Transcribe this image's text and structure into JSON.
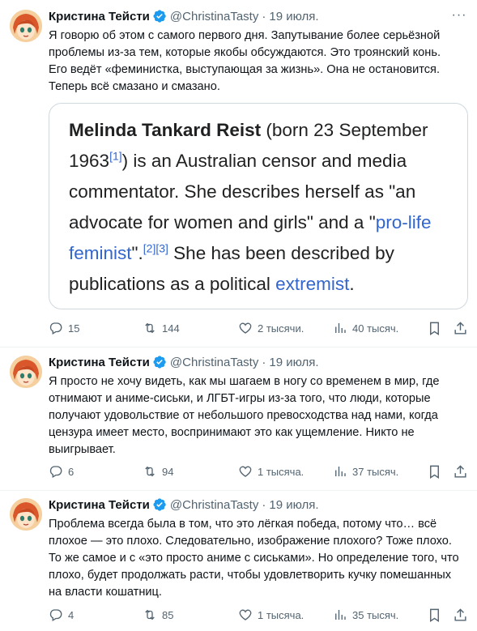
{
  "tweets": [
    {
      "name": "Кристина Тейсти",
      "handle": "@ChristinaTasty",
      "dot": "·",
      "date": "19 июля.",
      "lines": [
        "Я говорю об этом с самого первого дня. Запутывание более серьёзной",
        "проблемы из-за тем, которые якобы обсуждаются. Это троянский конь.",
        "Его ведёт «феминистка, выступающая за жизнь». Она не остановится.",
        "Теперь всё смазано и смазано."
      ],
      "actions": {
        "replies": "15",
        "reposts": "144",
        "likes": "2 тысячи.",
        "views": "40 тысяч."
      }
    },
    {
      "name": "Кристина Тейсти",
      "handle": "@ChristinaTasty",
      "dot": "·",
      "date": "19 июля.",
      "lines": [
        "Я просто не хочу видеть, как мы шагаем в ногу со временем в мир, где",
        "отнимают и аниме-сиськи, и ЛГБТ-игры из-за того, что люди, которые",
        "получают удовольствие от небольшого превосходства над нами, когда",
        "цензура имеет место, воспринимают это как ущемление. Никто не",
        "выигрывает."
      ],
      "actions": {
        "replies": "6",
        "reposts": "94",
        "likes": "1 тысяча.",
        "views": "37 тысяч."
      }
    },
    {
      "name": "Кристина Тейсти",
      "handle": "@ChristinaTasty",
      "dot": "·",
      "date": "19 июля.",
      "lines": [
        "Проблема всегда была в том, что это лёгкая победа, потому что… всё",
        "плохое — это плохо. Следовательно, изображение плохого? Тоже плохо.",
        "То же самое и с «это просто аниме с сиськами». Но определение того, что",
        "плохо, будет продолжать расти, чтобы удовлетворить кучку помешанных",
        "на власти кошатниц."
      ],
      "actions": {
        "replies": "4",
        "reposts": "85",
        "likes": "1 тысяча.",
        "views": "35 тысяч."
      }
    }
  ],
  "card": {
    "bold_name": "Melinda Tankard Reist",
    "born": " (born 23 September",
    "year": "1963",
    "ref1": "[1]",
    "after_ref1": ") is an Australian censor and media",
    "line3": "commentator. She describes herself as \"an",
    "line4a": "advocate for women and girls\" and a \"",
    "prolife": "pro-life",
    "feminist": "feminist",
    "after_feminist": "\".",
    "ref23": "[2][3]",
    "line5b": " She has been described by",
    "line6a": "publications as a political ",
    "extremist": "extremist",
    "period": "."
  },
  "colors": {
    "accent": "#1d9bf0",
    "muted": "#536471",
    "link": "#3366cc",
    "text": "#0f1419"
  }
}
